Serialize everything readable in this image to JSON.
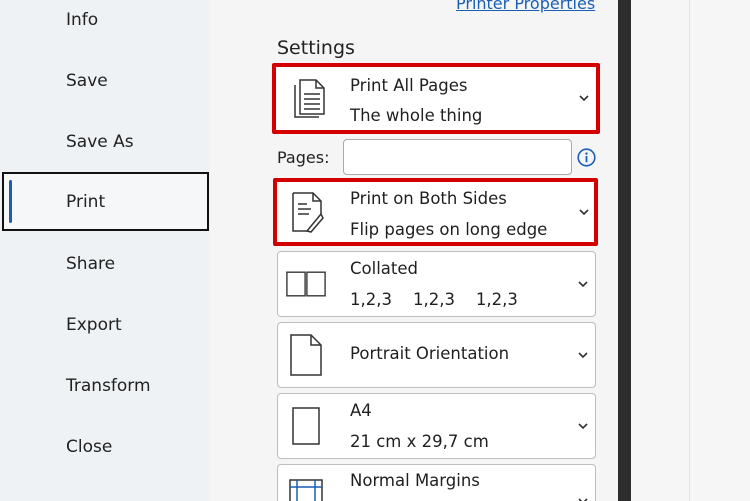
{
  "nav": {
    "items": [
      {
        "label": "Info"
      },
      {
        "label": "Save"
      },
      {
        "label": "Save As"
      },
      {
        "label": "Print",
        "active": true
      },
      {
        "label": "Share"
      },
      {
        "label": "Export"
      },
      {
        "label": "Transform"
      },
      {
        "label": "Close"
      }
    ]
  },
  "printer": {
    "properties_link": "Printer Properties"
  },
  "settings": {
    "title": "Settings",
    "pages_label": "Pages:",
    "pages_value": "",
    "pages_placeholder": "",
    "dropdowns": [
      {
        "line1": "Print All Pages",
        "line2": "The whole thing",
        "icon": "document-pages-icon",
        "highlighted": true
      },
      {
        "line1": "Print on Both Sides",
        "line2": "Flip pages on long edge",
        "icon": "duplex-print-icon",
        "highlighted": true
      },
      {
        "line1": "Collated",
        "line2": "1,2,3    1,2,3    1,2,3",
        "icon": "collated-icon",
        "highlighted": false
      },
      {
        "line1": "Portrait Orientation",
        "line2": "",
        "icon": "portrait-page-icon",
        "highlighted": false
      },
      {
        "line1": "A4",
        "line2": "21 cm x 29,7 cm",
        "icon": "paper-size-icon",
        "highlighted": false
      },
      {
        "line1": "Normal Margins",
        "line2": "",
        "icon": "margins-icon",
        "highlighted": false
      }
    ]
  },
  "colors": {
    "highlight": "#d40000",
    "link": "#1a5fb4",
    "active_bar": "#1a5fb4"
  }
}
